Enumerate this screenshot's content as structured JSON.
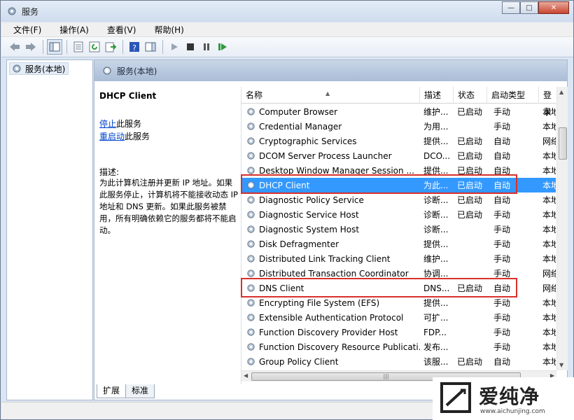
{
  "window": {
    "title": "服务"
  },
  "caption": {
    "minimize": "—",
    "maximize": "□",
    "close": "✕"
  },
  "menu": [
    "文件(F)",
    "操作(A)",
    "查看(V)",
    "帮助(H)"
  ],
  "tree": {
    "root": "服务(本地)"
  },
  "main": {
    "header": "服务(本地)"
  },
  "details": {
    "service_name": "DHCP Client",
    "stop_link": "停止",
    "stop_suffix": "此服务",
    "restart_link": "重启动",
    "restart_suffix": "此服务",
    "desc_label": "描述:",
    "desc_text": "为此计算机注册并更新 IP 地址。如果此服务停止，计算机将不能接收动态 IP 地址和 DNS 更新。如果此服务被禁用，所有明确依赖它的服务都将不能启动。"
  },
  "columns": [
    "名称",
    "描述",
    "状态",
    "启动类型",
    "登录"
  ],
  "rows": [
    [
      "Computer Browser",
      "维护...",
      "已启动",
      "手动",
      "本地"
    ],
    [
      "Credential Manager",
      "为用...",
      "",
      "手动",
      "本地"
    ],
    [
      "Cryptographic Services",
      "提供...",
      "已启动",
      "自动",
      "网络"
    ],
    [
      "DCOM Server Process Launcher",
      "DCO...",
      "已启动",
      "自动",
      "本地"
    ],
    [
      "Desktop Window Manager Session ...",
      "提供...",
      "已启动",
      "自动",
      "本地"
    ],
    [
      "DHCP Client",
      "为此...",
      "已启动",
      "自动",
      "本地"
    ],
    [
      "Diagnostic Policy Service",
      "诊断...",
      "已启动",
      "自动",
      "本地"
    ],
    [
      "Diagnostic Service Host",
      "诊断...",
      "已启动",
      "手动",
      "本地"
    ],
    [
      "Diagnostic System Host",
      "诊断...",
      "",
      "手动",
      "本地"
    ],
    [
      "Disk Defragmenter",
      "提供...",
      "",
      "手动",
      "本地"
    ],
    [
      "Distributed Link Tracking Client",
      "维护...",
      "",
      "手动",
      "本地"
    ],
    [
      "Distributed Transaction Coordinator",
      "协调...",
      "",
      "手动",
      "网络"
    ],
    [
      "DNS Client",
      "DNS...",
      "已启动",
      "自动",
      "网络"
    ],
    [
      "Encrypting File System (EFS)",
      "提供...",
      "",
      "手动",
      "本地"
    ],
    [
      "Extensible Authentication Protocol",
      "可扩...",
      "",
      "手动",
      "本地"
    ],
    [
      "Function Discovery Provider Host",
      "FDP...",
      "",
      "手动",
      "本地"
    ],
    [
      "Function Discovery Resource Publicati...",
      "发布...",
      "",
      "手动",
      "本地"
    ],
    [
      "Group Policy Client",
      "该服...",
      "已启动",
      "自动",
      "本地"
    ]
  ],
  "selected_row": 5,
  "tabs": [
    "扩展",
    "标准"
  ],
  "watermark": {
    "brand": "爱纯净",
    "url": "www.aichunjing.com"
  },
  "colors": {
    "selection": "#3399ff",
    "highlight_box": "#d9302a",
    "link": "#0044cc"
  }
}
